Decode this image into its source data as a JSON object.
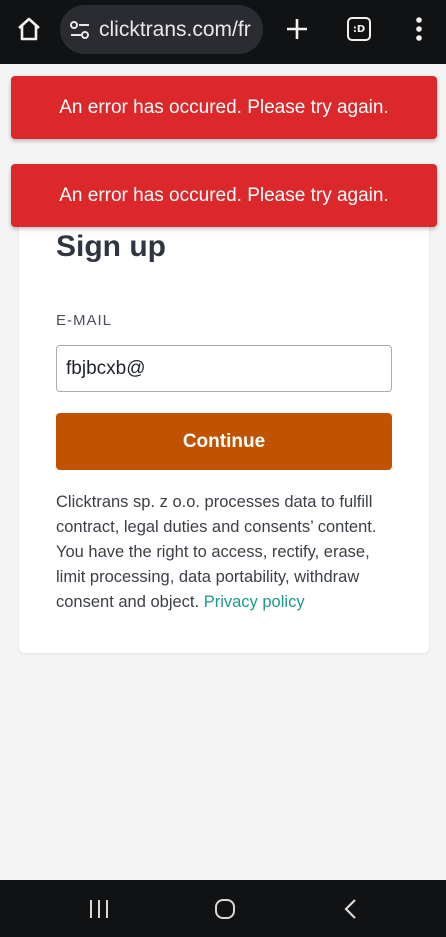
{
  "browser": {
    "url": "clicktrans.com/fr",
    "tabs_label": ":D",
    "icons": [
      "home-icon",
      "site-settings-icon",
      "plus-icon",
      "tabs-icon",
      "more-vert-icon"
    ]
  },
  "errors": [
    {
      "message": "An error has occured. Please try again."
    },
    {
      "message": "An error has occured. Please try again."
    }
  ],
  "signup": {
    "title": "Sign up",
    "email_label": "E-MAIL",
    "email_value": "fbjbcxb@",
    "continue_label": "Continue",
    "consent_text": "Clicktrans sp. z o.o. processes data to fulfill contract, legal duties and consents’ content. You have the right to access, rectify, erase, limit processing, data portability, withdraw consent and object.",
    "privacy_link": "Privacy policy"
  },
  "colors": {
    "error": "#dd282b",
    "button": "#c05200",
    "link": "#1a9a8a"
  },
  "nav": {
    "icons": [
      "recent-apps-icon",
      "home-circle-icon",
      "back-icon"
    ]
  }
}
